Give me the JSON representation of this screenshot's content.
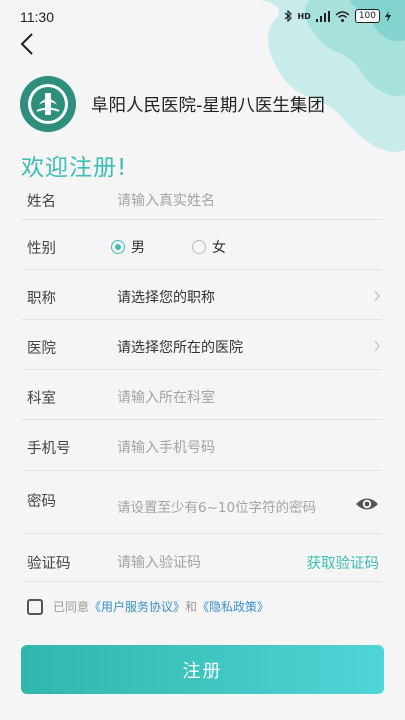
{
  "status_bar": {
    "time": "11:30",
    "signal_text": "HD",
    "battery": "100"
  },
  "header": {
    "org_name": "阜阳人民医院-星期八医生集团"
  },
  "welcome": "欢迎注册!",
  "form": {
    "name": {
      "label": "姓名",
      "placeholder": "请输入真实姓名"
    },
    "gender": {
      "label": "性别",
      "options": [
        "男",
        "女"
      ],
      "selected": "男"
    },
    "title": {
      "label": "职称",
      "value": "请选择您的职称"
    },
    "hospital": {
      "label": "医院",
      "value": "请选择您所在的医院"
    },
    "department": {
      "label": "科室",
      "placeholder": "请输入所在科室"
    },
    "phone": {
      "label": "手机号",
      "placeholder": "请输入手机号码"
    },
    "password": {
      "label": "密码",
      "placeholder": "请设置至少有6~10位字符的密码"
    },
    "code": {
      "label": "验证码",
      "placeholder": "请输入验证码",
      "action": "获取验证码"
    }
  },
  "agreement": {
    "prefix": "已同意",
    "terms": "《用户服务协议》",
    "and": "和",
    "privacy": "《隐私政策》",
    "checked": false
  },
  "submit_label": "注册",
  "colors": {
    "accent": "#3cbdb6",
    "link": "#3b8fcf"
  }
}
